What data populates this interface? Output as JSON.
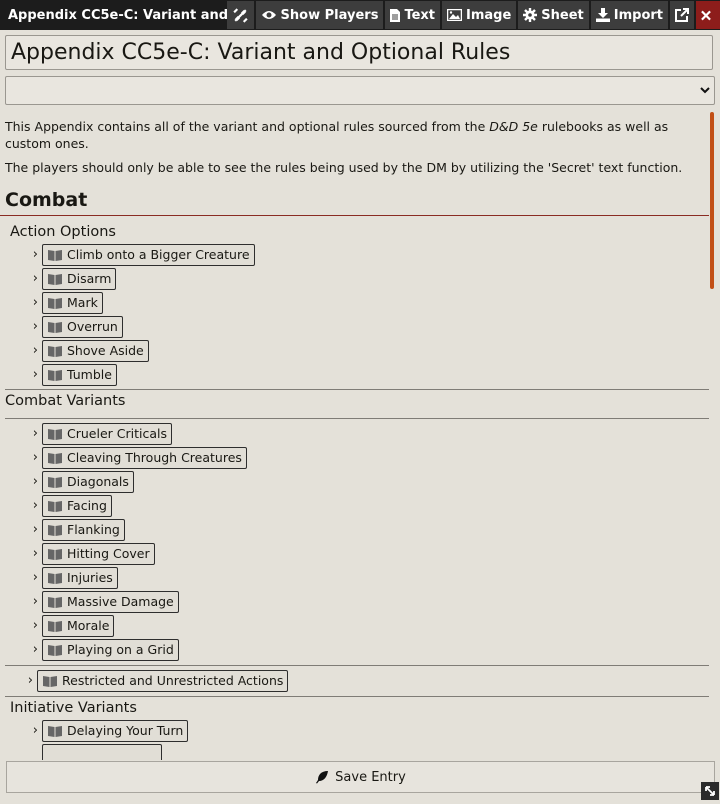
{
  "window": {
    "title": "Appendix CC5e-C: Variant and Optional Rules",
    "buttons": {
      "show_players": "Show Players",
      "text": "Text",
      "image": "Image",
      "sheet": "Sheet",
      "import": "Import"
    }
  },
  "entry": {
    "title": "Appendix CC5e-C: Variant and Optional Rules",
    "select_value": ""
  },
  "intro": {
    "p1_before": "This Appendix contains all of the variant and optional rules sourced from the ",
    "p1_italic": "D&D 5e",
    "p1_after": " rulebooks as well as custom ones.",
    "p2": "The players should only be able to see the rules being used by the DM by utilizing the 'Secret' text function."
  },
  "sections": {
    "combat": "Combat",
    "action_options": {
      "heading": "Action Options",
      "items": [
        "Climb onto a Bigger Creature",
        "Disarm",
        "Mark",
        "Overrun",
        "Shove Aside",
        "Tumble"
      ]
    },
    "combat_variants": {
      "heading": "Combat Variants",
      "items": [
        "Crueler Criticals",
        "Cleaving Through Creatures",
        "Diagonals",
        "Facing",
        "Flanking",
        "Hitting Cover",
        "Injuries",
        "Massive Damage",
        "Morale",
        "Playing on a Grid"
      ]
    },
    "restricted": "Restricted and Unrestricted Actions",
    "initiative_variants": {
      "heading": "Initiative Variants",
      "items": [
        "Delaying Your Turn"
      ]
    }
  },
  "footer": {
    "save_label": "Save Entry"
  },
  "colors": {
    "header_bg": "#1c1c1c",
    "close_bg": "#8d1d1b",
    "accent_rule": "#8a2c23",
    "scrollbar": "#c24f16"
  },
  "icons": [
    "unlink-icon",
    "eye-icon",
    "file-icon",
    "image-icon",
    "gear-icon",
    "download-icon",
    "external-link-icon",
    "close-icon",
    "chevron-down-icon",
    "book-icon",
    "feather-icon",
    "resize-icon"
  ]
}
